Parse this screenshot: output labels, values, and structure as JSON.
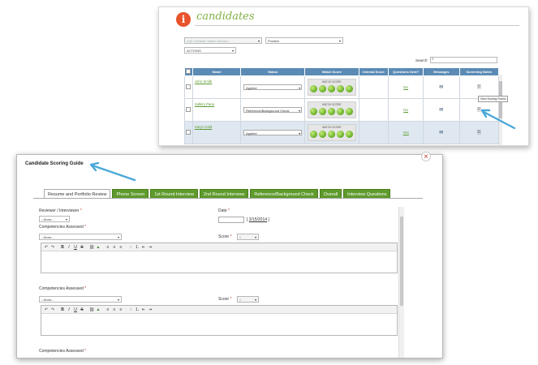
{
  "back": {
    "brand_title": "candidates",
    "filter_school": "Hull Christian Toledo School I",
    "filter_position": "Position",
    "filter_actions": "ACTIONS",
    "search_label": "Search:",
    "columns": [
      "Name",
      "Status",
      "Watch Score",
      "Internal Score",
      "Questions Sent?",
      "Messages",
      "Screening Notes"
    ],
    "rows": [
      {
        "name": "John Smith",
        "status": "Applied",
        "questions_sent": "No"
      },
      {
        "name": "Sallery Pane",
        "status": "Reference/Background Check",
        "questions_sent": "No"
      },
      {
        "name": "Karyn Gold",
        "status": "Applied",
        "questions_sent": "Yes"
      }
    ],
    "watch_score_label": "WATCH SCORE",
    "tooltip": "View Scoring Rubric"
  },
  "modal": {
    "title": "Candidate Scoring Guide",
    "tabs": [
      "Resume and Portfolio Review",
      "Phone Screen",
      "1st Round Interview",
      "2nd Round Interview",
      "Reference/Background Check",
      "Overall",
      "Interview Questions"
    ],
    "reviewer_label": "Reviewer / Interviewer",
    "reviewer_value": "--None--",
    "date_label": "Date",
    "date_value": "3/15/2014",
    "competencies_label": "Competencies Assessed",
    "competencies_value": "--None--",
    "score_label": "Score",
    "score_value": "0",
    "req_mark": "*"
  }
}
